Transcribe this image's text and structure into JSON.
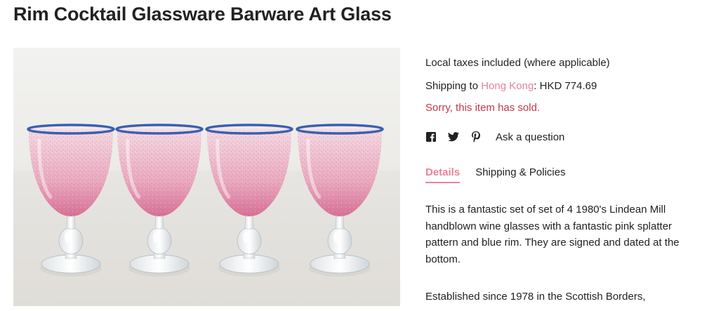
{
  "product": {
    "title": "Rim Cocktail Glassware Barware Art Glass",
    "image_alt": "Four pink splatter wine glasses with blue rims"
  },
  "info": {
    "taxes": "Local taxes included (where applicable)",
    "shipping_prefix": "Shipping to ",
    "shipping_location": "Hong Kong",
    "shipping_suffix": ": HKD 774.69",
    "sold_notice": "Sorry, this item has sold."
  },
  "share": {
    "icons": [
      "facebook-icon",
      "twitter-icon",
      "pinterest-icon"
    ],
    "ask_label": "Ask a question"
  },
  "tabs": [
    {
      "label": "Details",
      "active": true
    },
    {
      "label": "Shipping & Policies",
      "active": false
    }
  ],
  "description": {
    "paragraph1": "This is a fantastic set of set of 4 1980's Lindean Mill handblown wine glasses with a fantastic pink splatter pattern and blue rim. They are signed and dated at the bottom.",
    "paragraph2": "Established since 1978 in the Scottish Borders,"
  },
  "colors": {
    "accent_pink": "#e6849a",
    "sold_red": "#c0394b",
    "rim_blue": "#3b5fb0"
  }
}
